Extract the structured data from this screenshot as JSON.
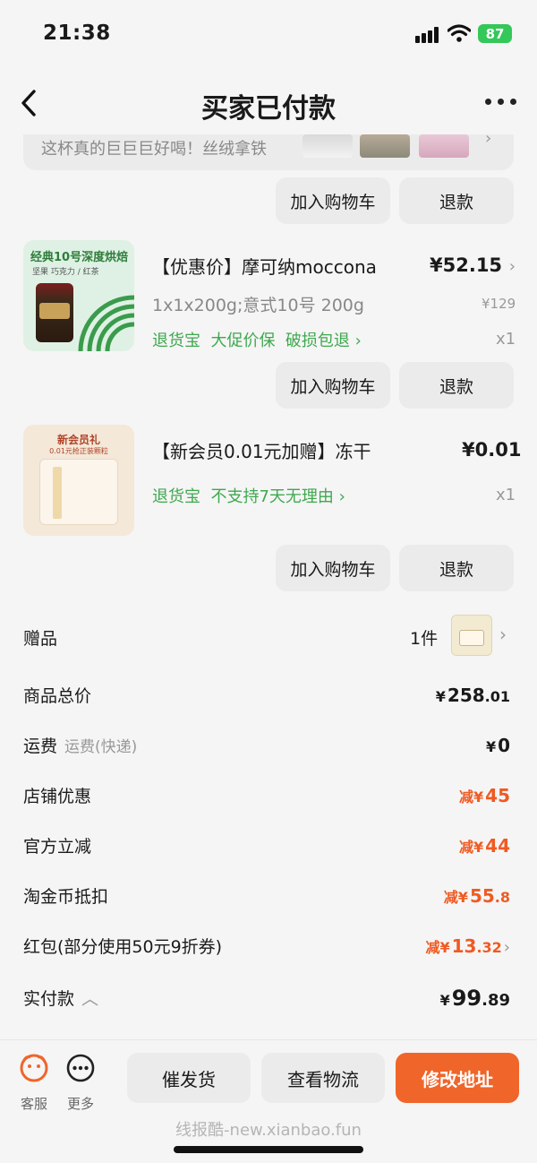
{
  "status": {
    "time": "21:38",
    "battery": "87"
  },
  "nav": {
    "title": "买家已付款"
  },
  "promo": {
    "text": "这杯真的巨巨巨好喝！丝绒拿铁"
  },
  "actions": {
    "add_to_cart": "加入购物车",
    "refund": "退款"
  },
  "products": [
    {
      "title": "【优惠价】摩可纳moccona",
      "price": "¥52.15",
      "spec": "1x1x200g;意式10号 200g",
      "original_price": "¥129",
      "services": "退货宝  大促价保  破损包退",
      "qty": "x1",
      "image_text": "经典10号深度烘焙",
      "image_sub": "坚果  巧克力 / 红茶"
    },
    {
      "title": "【新会员0.01元加赠】冻干",
      "price": "¥0.01",
      "services": "退货宝  不支持7天无理由",
      "qty": "x1",
      "image_text": "新会员礼",
      "image_sub": "0.01元抢正装颗粒"
    }
  ],
  "gift": {
    "label": "赠品",
    "count": "1件"
  },
  "summary": {
    "subtotal": {
      "label": "商品总价",
      "cur": "¥",
      "int": "258",
      "dec": ".01"
    },
    "shipping": {
      "label": "运费",
      "sublabel": "运费(快递)",
      "cur": "¥",
      "int": "0",
      "dec": ""
    },
    "store_discount": {
      "label": "店铺优惠",
      "prefix": "减",
      "cur": "¥",
      "int": "45",
      "dec": ""
    },
    "official_discount": {
      "label": "官方立减",
      "prefix": "减",
      "cur": "¥",
      "int": "44",
      "dec": ""
    },
    "coins": {
      "label": "淘金币抵扣",
      "prefix": "减",
      "cur": "¥",
      "int": "55",
      "dec": ".8"
    },
    "red_packet": {
      "label": "红包(部分使用50元9折券)",
      "prefix": "减",
      "cur": "¥",
      "int": "13",
      "dec": ".32"
    },
    "paid": {
      "label": "实付款",
      "cur": "¥",
      "int": "99",
      "dec": ".89"
    }
  },
  "bottom": {
    "service_label": "客服",
    "more_label": "更多",
    "urge_label": "催发货",
    "logistics_label": "查看物流",
    "address_label": "修改地址",
    "watermark": "线报酷-new.xianbao.fun"
  },
  "colors": {
    "accent": "#f0652a",
    "discount": "#f05a22",
    "service_green": "#3fa84f"
  },
  "icons": [
    "back-icon",
    "more-icon",
    "chevron-right-icon",
    "service-icon",
    "more-circle-icon",
    "chevron-up-icon"
  ]
}
